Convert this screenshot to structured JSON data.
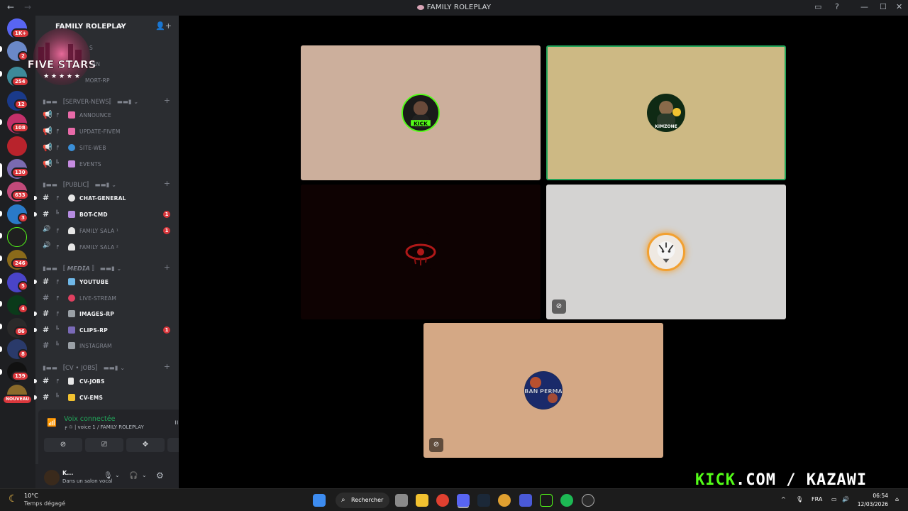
{
  "window": {
    "title": "FAMILY ROLEPLAY",
    "back": "←",
    "forward": "→"
  },
  "server_rail": {
    "badges": [
      "1K+",
      "2",
      "254",
      "12",
      "108",
      "130",
      "633",
      "3",
      "246",
      "5",
      "4",
      "86",
      "8",
      "139",
      "NOUVEAU"
    ]
  },
  "sidebar": {
    "server_name": "FAMILY ROLEPLAY",
    "logo_text": "FIVE STARS",
    "logo_stars": "★ ★ ★ ★ ★",
    "top_channels": [
      "S",
      "RN",
      "MORT-RP"
    ],
    "categories": [
      {
        "label": "▮▬▬ 〚SERVER-NEWS〛 ▬▬▮ ⌄",
        "channels": [
          {
            "name": "ANNOUNCE",
            "tree": "╒",
            "emoji_color": "#e86aa8",
            "bright": false
          },
          {
            "name": "UPDATE-FIVEM",
            "tree": "╒",
            "emoji_color": "#e86aa8",
            "bright": false
          },
          {
            "name": "SITE-WEB",
            "tree": "╒",
            "emoji_color": "#3a8fd8",
            "bright": false
          },
          {
            "name": "EVENTS",
            "tree": "╚",
            "emoji_color": "#c58be0",
            "bright": false
          }
        ]
      },
      {
        "label": "▮▬▬ 〚PUBLIC〛 ▬▬▮ ⌄",
        "channels": [
          {
            "name": "CHAT-GENERAL",
            "tree": "╒",
            "emoji_color": "#e6e6e6",
            "bright": true,
            "unread": true
          },
          {
            "name": "BOT-CMD",
            "tree": "╚",
            "emoji_color": "#b58be0",
            "bright": true,
            "unread": true,
            "mentions": "1"
          },
          {
            "name": "FAMILY SALA ¹",
            "tree": "╒",
            "emoji_color": "#e6e6e6",
            "bright": false,
            "mentions": "1"
          },
          {
            "name": "FAMILY SALA ²",
            "tree": "╒",
            "emoji_color": "#e6e6e6",
            "bright": false
          }
        ]
      },
      {
        "label": "▮▬▬ 〚 𝙈𝙀𝘿𝙄𝘼 〛 ▬▬▮ ⌄",
        "channels": [
          {
            "name": "YOUTUBE",
            "tree": "╒",
            "emoji_color": "#6fb8e8",
            "bright": true,
            "unread": true
          },
          {
            "name": "LIVE-STREAM",
            "tree": "╒",
            "emoji_color": "#e04060",
            "bright": false
          },
          {
            "name": "IMAGES-RP",
            "tree": "╒",
            "emoji_color": "#9aa0a6",
            "bright": true,
            "unread": true
          },
          {
            "name": "CLIPS-RP",
            "tree": "╚",
            "emoji_color": "#7a6ab8",
            "bright": true,
            "unread": true,
            "mentions": "1"
          },
          {
            "name": "INSTAGRAM",
            "tree": "╚",
            "emoji_color": "#9aa0a6",
            "bright": false
          }
        ]
      },
      {
        "label": "▮▬▬ 〚CV • JOBS〛 ▬▬▮ ⌄",
        "channels": [
          {
            "name": "CV-JOBS",
            "tree": "╒",
            "emoji_color": "#e6e6e6",
            "bright": true,
            "unread": true
          },
          {
            "name": "CV-EMS",
            "tree": "╚",
            "emoji_color": "#f2c230",
            "bright": true,
            "unread": true
          }
        ]
      }
    ]
  },
  "voice_panel": {
    "status": "Voix connectée",
    "channel": "╒ ♲ | voice 1 / FAMILY ROLEPLAY",
    "buttons": [
      "camera-off",
      "screen-share",
      "activities",
      "soundboard"
    ]
  },
  "user_panel": {
    "username": "K...",
    "status": "Dans un salon vocal"
  },
  "stage": {
    "tiles": [
      {
        "name": "tile-kick",
        "bg": "#ccaf9c",
        "avatar_label": "KICK",
        "speaking": false,
        "muted": false
      },
      {
        "name": "tile-kimzone",
        "bg": "#cdb984",
        "avatar_label": "KIMZONE",
        "speaking": true,
        "muted": false
      },
      {
        "name": "tile-eye",
        "bg": "#0e0202",
        "avatar_label": "",
        "speaking": false,
        "muted": false
      },
      {
        "name": "tile-tiger",
        "bg": "#d4d3d2",
        "avatar_label": "",
        "speaking": false,
        "muted": true
      },
      {
        "name": "tile-banperma",
        "bg": "#d4a885",
        "avatar_label": "BAN PERMA",
        "speaking": false,
        "muted": true
      }
    ],
    "watermark_kick": "KICK",
    "watermark_rest": ".COM / KAZAWI"
  },
  "taskbar": {
    "temperature": "10°C",
    "weather": "Temps dégagé",
    "search_label": "Rechercher",
    "language": "FRA",
    "time": "06:54",
    "date": "12/03/2026"
  },
  "colors": {
    "accent_green": "#23a55a",
    "mention_red": "#da373c",
    "kick_green": "#53fc18"
  }
}
